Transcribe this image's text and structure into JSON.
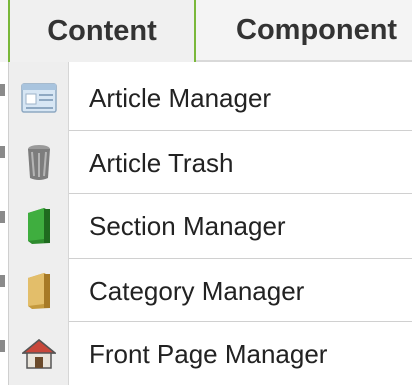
{
  "menubar": {
    "active_tab": "Content",
    "next_tab": "Component"
  },
  "dropdown": {
    "items": [
      {
        "label": "Article Manager",
        "icon": "article-manager-icon"
      },
      {
        "label": "Article Trash",
        "icon": "trash-can-icon"
      },
      {
        "label": "Section Manager",
        "icon": "section-book-icon"
      },
      {
        "label": "Category Manager",
        "icon": "category-book-icon"
      },
      {
        "label": "Front Page Manager",
        "icon": "home-icon"
      }
    ]
  },
  "colors": {
    "active_tab_border": "#7ab83a",
    "menu_background": "#ffffff",
    "icon_gutter": "#eeeeee",
    "text": "#222222"
  }
}
